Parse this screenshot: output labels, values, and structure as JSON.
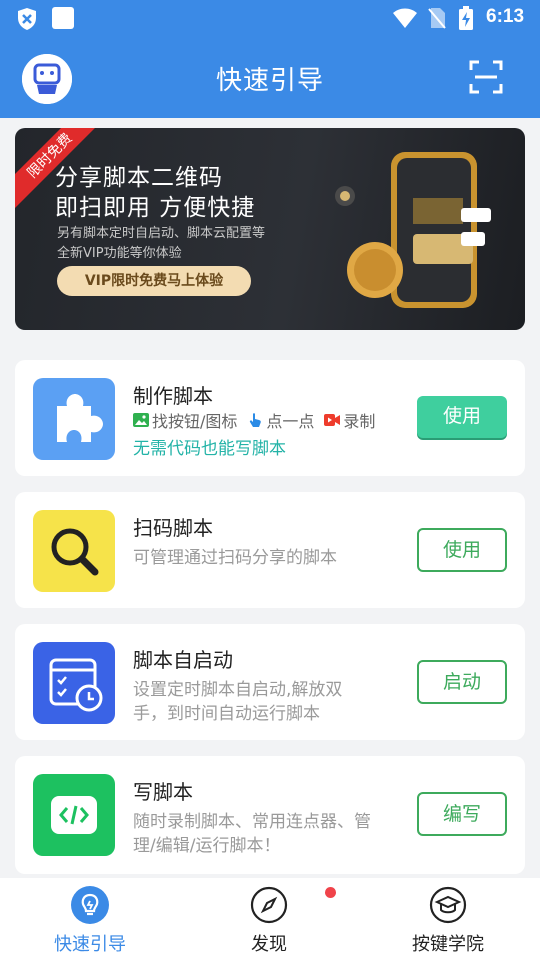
{
  "status_bar": {
    "time": "6:13"
  },
  "header": {
    "title": "快速引导"
  },
  "banner": {
    "ribbon": "限时免费",
    "title_line1": "分享脚本二维码",
    "title_line2": "即扫即用 方便快捷",
    "sub_line1": "另有脚本定时自启动、脚本云配置等",
    "sub_line2": "全新VIP功能等你体验",
    "button": "VIP限时免费马上体验"
  },
  "cards": [
    {
      "title": "制作脚本",
      "features": [
        "找按钮/图标",
        "点一点",
        "录制"
      ],
      "highlight": "无需代码也能写脚本",
      "button": "使用"
    },
    {
      "title": "扫码脚本",
      "desc": "可管理通过扫码分享的脚本",
      "button": "使用"
    },
    {
      "title": "脚本自启动",
      "desc": "设置定时脚本自启动,解放双手，到时间自动运行脚本",
      "button": "启动"
    },
    {
      "title": "写脚本",
      "desc": "随时录制脚本、常用连点器、管理/编辑/运行脚本！",
      "button": "编写"
    }
  ],
  "bottom_nav": [
    {
      "label": "快速引导",
      "icon": "lightbulb-icon",
      "active": true
    },
    {
      "label": "发现",
      "icon": "compass-icon",
      "active": false
    },
    {
      "label": "按键学院",
      "icon": "graduation-cap-icon",
      "active": false
    }
  ],
  "colors": {
    "primary": "#3b8ae6",
    "green": "#3daa5c",
    "teal": "#3fcf9e"
  }
}
